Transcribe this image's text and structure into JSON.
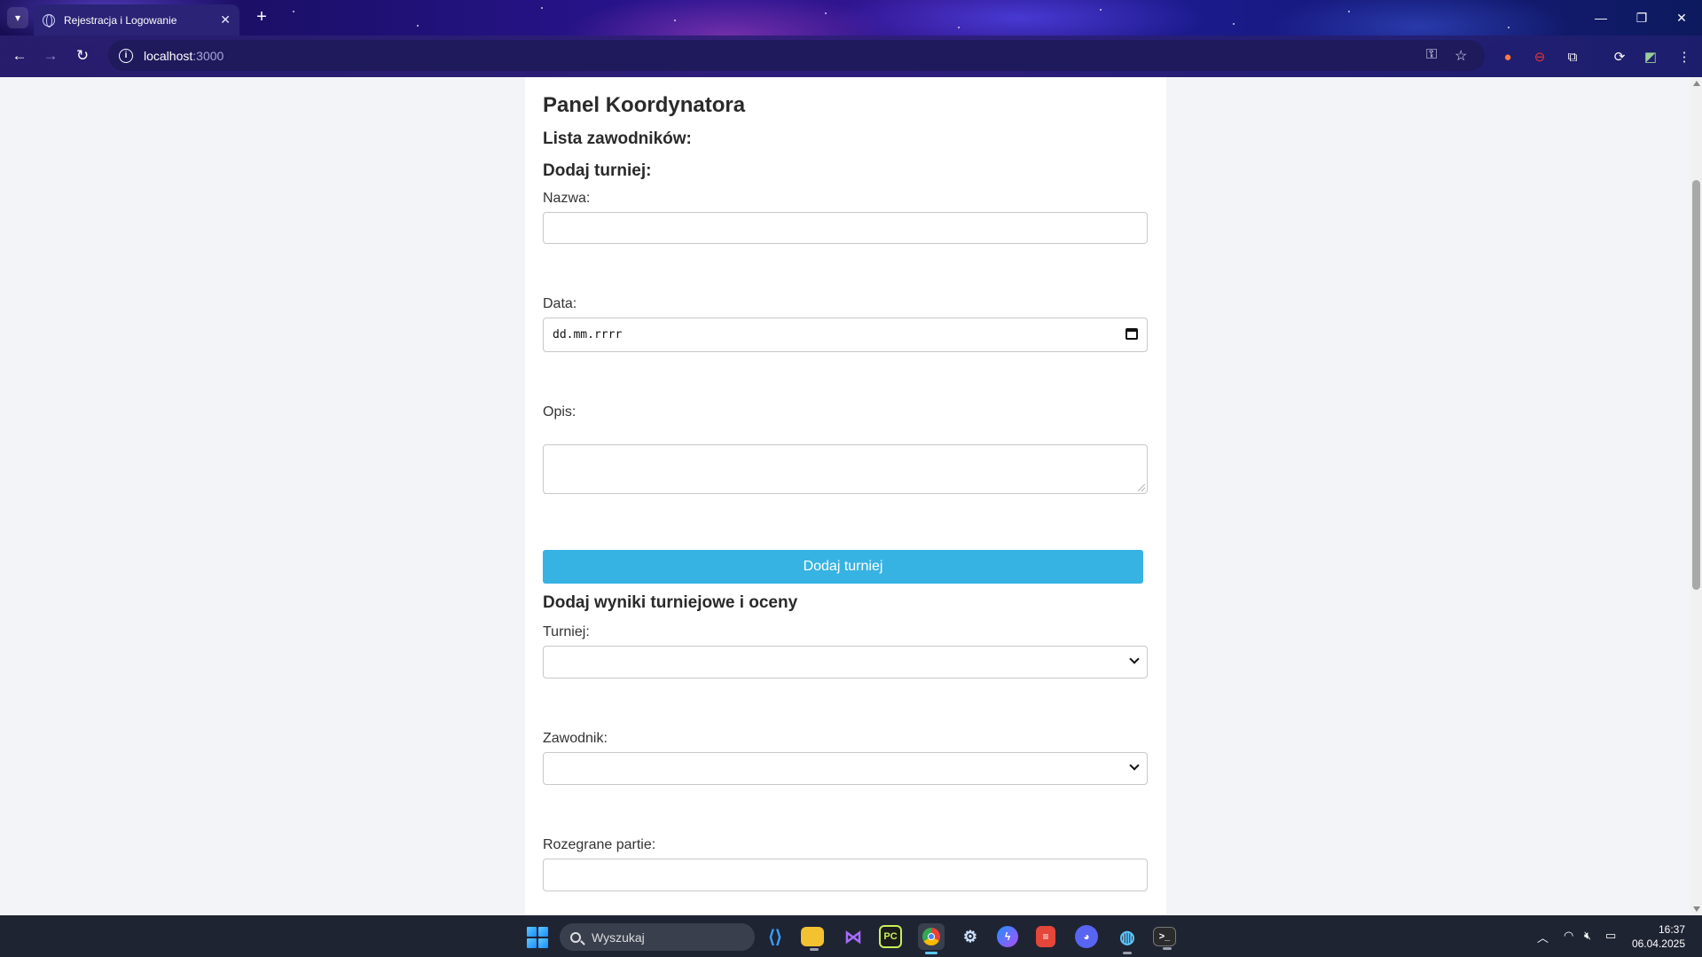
{
  "browser": {
    "tab_title": "Rejestracja i Logowanie",
    "url_host": "localhost",
    "url_port": ":3000"
  },
  "page": {
    "title": "Panel Koordynatora",
    "players_heading": "Lista zawodników:",
    "add_tournament_heading": "Dodaj turniej:",
    "name_label": "Nazwa:",
    "name_value": "",
    "date_label": "Data:",
    "date_placeholder": "dd.mm.rrrr",
    "description_label": "Opis:",
    "description_value": "",
    "add_tournament_button": "Dodaj turniej",
    "results_heading": "Dodaj wyniki turniejowe i oceny",
    "tournament_label": "Turniej:",
    "tournament_selected": "",
    "player_label": "Zawodnik:",
    "player_selected": "",
    "games_played_label": "Rozegrane partie:",
    "games_played_value": ""
  },
  "taskbar": {
    "search_placeholder": "Wyszukaj",
    "time": "16:37",
    "date": "06.04.2025"
  },
  "colors": {
    "button": "#36b3e3",
    "page_bg": "#f3f4f8",
    "panel_bg": "#ffffff"
  }
}
